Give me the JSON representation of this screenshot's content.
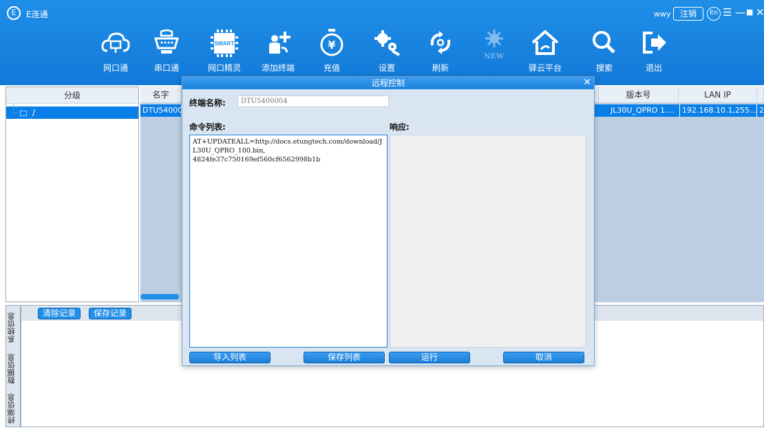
{
  "app": {
    "title": "E连通",
    "logo": "E",
    "user": "wwy",
    "logout_label": "注销",
    "lang_label": "En"
  },
  "toolbar": [
    {
      "label": "网口通",
      "icon": "cloud-network-icon"
    },
    {
      "label": "串口通",
      "icon": "serial-port-icon"
    },
    {
      "label": "网口精灵",
      "icon": "smart-chip-icon",
      "icon_text": "SMART"
    },
    {
      "label": "添加终端",
      "icon": "add-terminal-icon"
    },
    {
      "label": "充值",
      "icon": "recharge-icon"
    },
    {
      "label": "设置",
      "icon": "settings-gears-icon"
    },
    {
      "label": "刷新",
      "icon": "refresh-icon"
    },
    {
      "label": "",
      "icon": "new-feature-icon",
      "badge": "NEW",
      "disabled": true
    },
    {
      "label": "驿云平台",
      "icon": "cloud-platform-home-icon"
    },
    {
      "label": "搜索",
      "icon": "search-icon"
    },
    {
      "label": "退出",
      "icon": "exit-icon"
    }
  ],
  "left_panel": {
    "header": "分级",
    "tree_root": "/"
  },
  "table": {
    "columns": [
      "名字",
      "",
      "版本号",
      "LAN IP",
      ""
    ],
    "rows": [
      {
        "name": "DTU54000",
        "version": "JL30U_QPRO 1....",
        "lan_ip": "192.168.10.1,255....",
        "extra": "2"
      }
    ]
  },
  "log": {
    "clear_label": "清除记录",
    "save_label": "保存记录",
    "tabs": [
      "系统信息",
      "数据信息",
      "终端信息"
    ]
  },
  "dialog": {
    "title": "远程控制",
    "terminal_name_label": "终端名称:",
    "terminal_name_value": "DTU5400004",
    "command_list_label": "命令列表:",
    "response_label": "响应:",
    "command_text": "AT+UPDATEALL=http://docs.etungtech.com/download/JL30U_QPRO_100.bin,\n4824fe37c750169ef560cf6562998b1b",
    "buttons": {
      "import": "导入列表",
      "save": "保存列表",
      "run": "运行",
      "cancel": "取消"
    }
  },
  "colors": {
    "title_bar": "#1f8fe8",
    "selection": "#0a7fe8",
    "dialog_bg": "#d9e6f2"
  }
}
